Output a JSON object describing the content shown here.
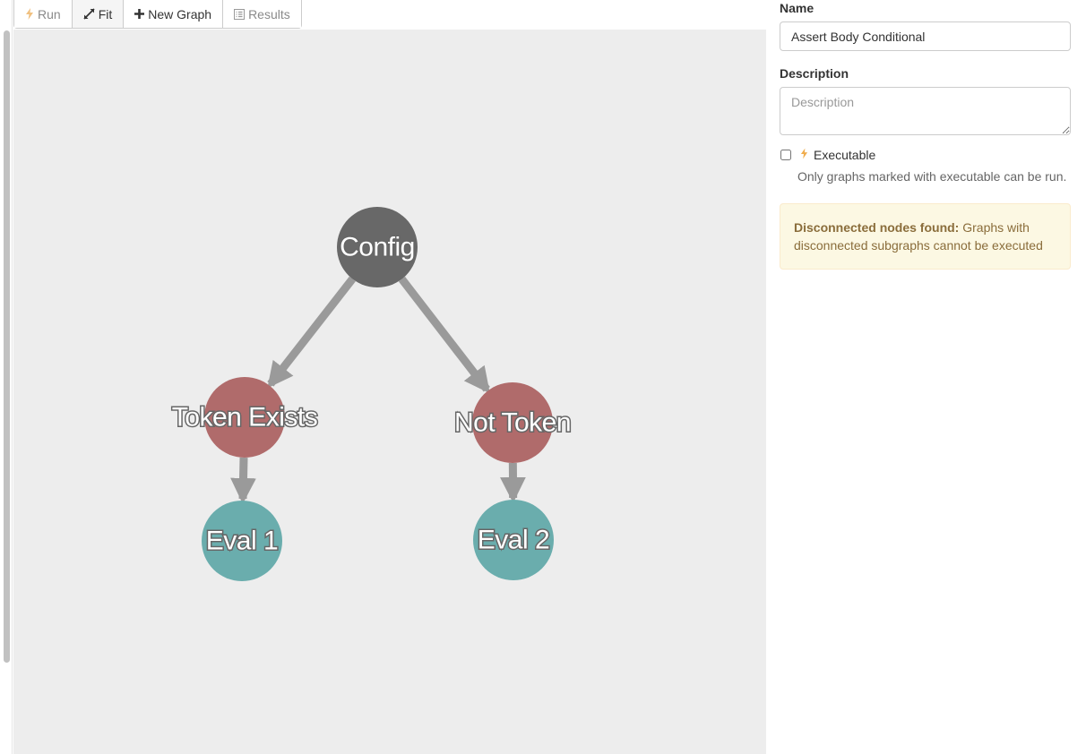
{
  "toolbar": {
    "run_label": "Run",
    "fit_label": "Fit",
    "new_graph_label": "New Graph",
    "results_label": "Results"
  },
  "graph": {
    "nodes": [
      {
        "id": "config",
        "label": "Config",
        "color": "#686868"
      },
      {
        "id": "token-exists",
        "label": "Token Exists",
        "color": "#b06b6b"
      },
      {
        "id": "not-token",
        "label": "Not Token",
        "color": "#b06b6b"
      },
      {
        "id": "eval1",
        "label": "Eval 1",
        "color": "#6aadad"
      },
      {
        "id": "eval2",
        "label": "Eval 2",
        "color": "#6aadad"
      }
    ],
    "edges": [
      {
        "from": "config",
        "to": "token-exists"
      },
      {
        "from": "config",
        "to": "not-token"
      },
      {
        "from": "token-exists",
        "to": "eval1"
      },
      {
        "from": "not-token",
        "to": "eval2"
      }
    ],
    "edge_color": "#9a9a9a",
    "background": "#ededed"
  },
  "panel": {
    "name_label": "Name",
    "name_value": "Assert Body Conditional",
    "description_label": "Description",
    "description_placeholder": "Description",
    "executable_label": "Executable",
    "executable_checked": false,
    "executable_help": "Only graphs marked with executable can be run.",
    "alert_title": "Disconnected nodes found:",
    "alert_text": "Graphs with disconnected subgraphs cannot be executed"
  },
  "colors": {
    "accent_bolt": "#f0ad4e",
    "alert_bg": "#fcf8e3",
    "alert_text": "#8a6d3b"
  }
}
